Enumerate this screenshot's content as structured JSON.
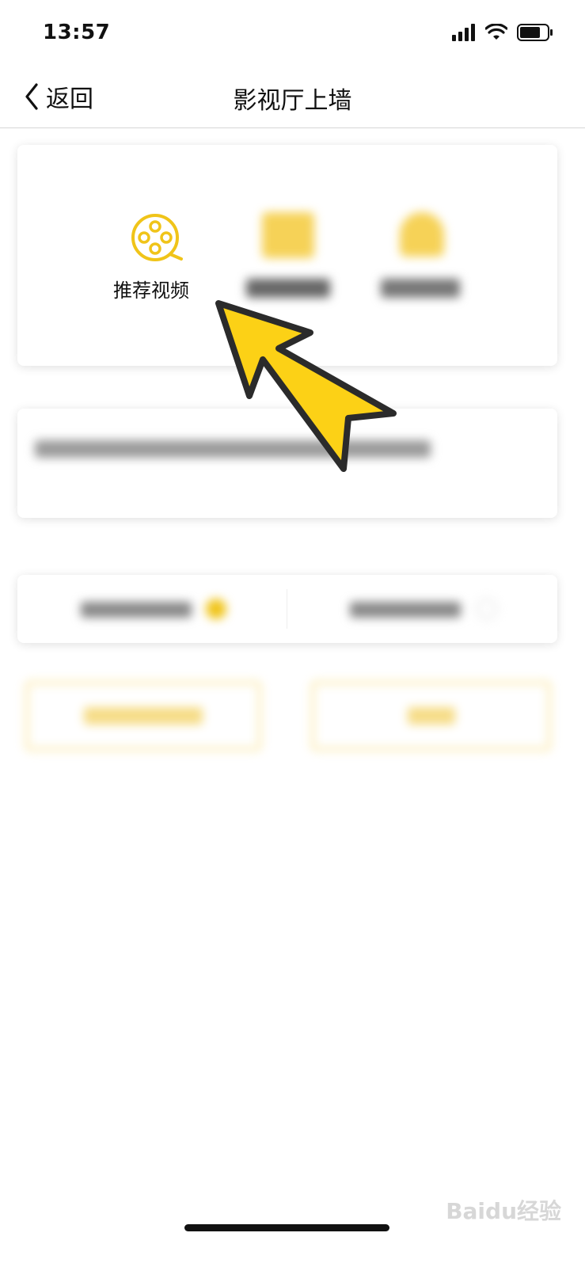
{
  "status_bar": {
    "time": "13:57",
    "icons": [
      "cellular-signal-icon",
      "wifi-icon",
      "battery-icon"
    ]
  },
  "nav": {
    "back_label": "返回",
    "title": "影视厅上墙"
  },
  "options": {
    "recommended_video_label": "推荐视频"
  },
  "colors": {
    "accent": "#f0c419",
    "arrow_fill": "#fcd116",
    "arrow_stroke": "#2b2b2b"
  },
  "watermark": "Baidu经验"
}
